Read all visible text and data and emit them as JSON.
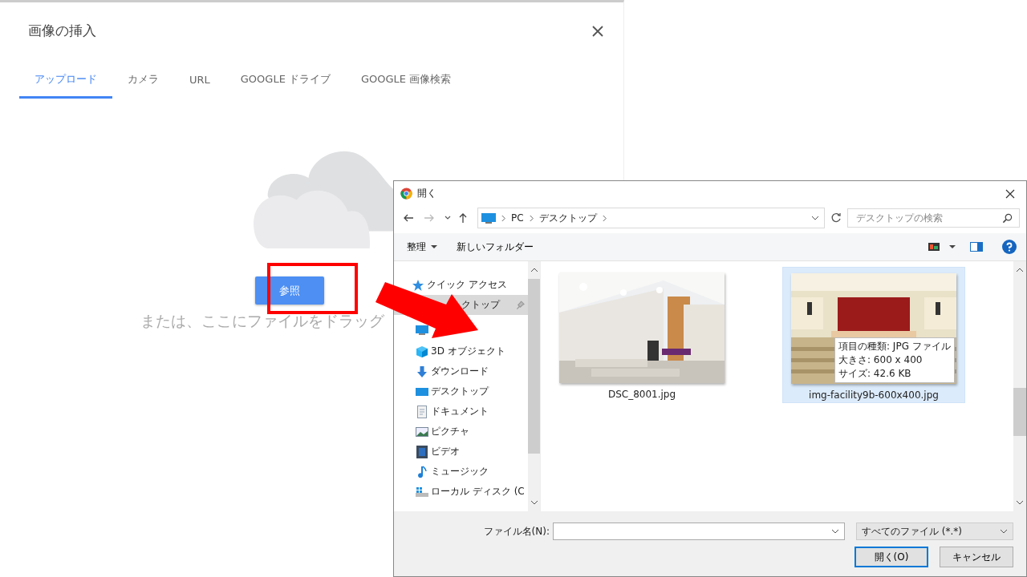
{
  "upload_dialog": {
    "title": "画像の挿入",
    "tabs": [
      {
        "label": "アップロード",
        "selected": true
      },
      {
        "label": "カメラ",
        "selected": false
      },
      {
        "label": "URL",
        "selected": false
      },
      {
        "label": "GOOGLE ドライブ",
        "selected": false
      },
      {
        "label": "GOOGLE 画像検索",
        "selected": false
      }
    ],
    "browse_button": "参照",
    "drop_hint": "または、ここにファイルをドラッグ"
  },
  "file_dialog": {
    "title": "開く",
    "path": [
      "PC",
      "デスクトップ"
    ],
    "search": {
      "placeholder": "デスクトップの検索"
    },
    "toolbar": {
      "organize": "整理",
      "new_folder": "新しいフォルダー"
    },
    "sidebar": {
      "items": [
        {
          "label": "クイック アクセス",
          "kind": "quick",
          "selected": false
        },
        {
          "label": "クトップ",
          "kind": "pinned",
          "selected": true
        },
        {
          "kind": "pc",
          "selected": false
        },
        {
          "label": "3D オブジェクト",
          "kind": "cube",
          "selected": false
        },
        {
          "label": "ダウンロード",
          "kind": "download",
          "selected": false
        },
        {
          "label": "デスクトップ",
          "kind": "desktop",
          "selected": false
        },
        {
          "label": "ドキュメント",
          "kind": "document",
          "selected": false
        },
        {
          "label": "ピクチャ",
          "kind": "pictures",
          "selected": false
        },
        {
          "label": "ビデオ",
          "kind": "video",
          "selected": false
        },
        {
          "label": "ミュージック",
          "kind": "music",
          "selected": false
        },
        {
          "label": "ローカル ディスク (C",
          "kind": "disk",
          "selected": false
        }
      ]
    },
    "files": [
      {
        "name": "DSC_8001.jpg",
        "kind": "chapel",
        "selected": false
      },
      {
        "name": "img-facility9b-600x400.jpg",
        "kind": "hall",
        "selected": true,
        "tooltip": [
          "項目の種類: JPG ファイル",
          "大きさ: 600 x 400",
          "サイズ: 42.6 KB"
        ]
      }
    ],
    "file_name": {
      "label": "ファイル名(N):"
    },
    "file_type": "すべてのファイル (*.*)",
    "buttons": [
      {
        "label": "開く(O)",
        "kind": "primary"
      },
      {
        "label": "キャンセル",
        "kind": "normal"
      }
    ]
  }
}
